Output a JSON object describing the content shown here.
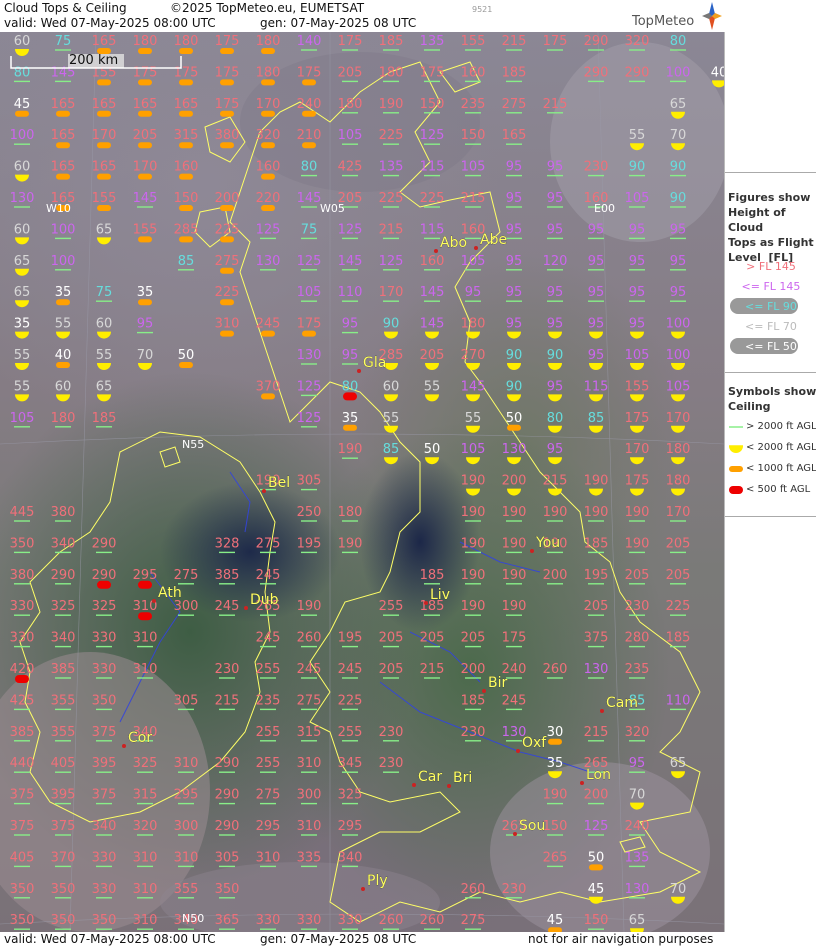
{
  "header": {
    "title": "Cloud Tops & Ceiling",
    "copyright": "©2025 TopMeteo.eu, EUMETSAT",
    "valid": "valid:  Wed   07-May-2025   08:00 UTC",
    "gen": "gen:  07-May-2025  08 UTC",
    "image_number": "9521",
    "brand": "TopMeteo"
  },
  "footer": {
    "valid": "valid:  Wed   07-May-2025   08:00 UTC",
    "gen": "gen:  07-May-2025  08 UTC",
    "disclaimer": "not for air navigation purposes"
  },
  "map": {
    "scale_label": "200 km",
    "grid_labels": [
      "W10",
      "W05",
      "E00",
      "N55",
      "N50"
    ],
    "cities": [
      "Abo",
      "Abe",
      "Gla",
      "Bel",
      "You",
      "Ath",
      "Dub",
      "Liv",
      "Bir",
      "Cam",
      "Cor",
      "Oxf",
      "Lon",
      "Car",
      "Bri",
      "Sou",
      "Ply"
    ],
    "colors": {
      "above_145": "#f0707a",
      "le_145": "#cc66ee",
      "le_90": "#66dddd",
      "le_70": "#d8d8d8",
      "le_50": "#ffffff",
      "ceiling_gt2000": "#88ee88",
      "ceiling_lt2000": "#ffee00",
      "ceiling_lt1000": "#ffa000",
      "ceiling_lt500": "#ee0000",
      "coast": "#ffff66",
      "river": "#3344dd"
    },
    "rows": [
      [
        "60",
        "75",
        "165",
        "180",
        "180",
        "175",
        "180",
        "140",
        "175",
        "185",
        "135",
        "155",
        "215",
        "175",
        "290",
        "320",
        "80"
      ],
      [
        "80",
        "145",
        "155",
        "175",
        "175",
        "175",
        "180",
        "175",
        "205",
        "180",
        "175",
        "160",
        "185",
        "",
        "290",
        "290",
        "100",
        "40"
      ],
      [
        "45",
        "165",
        "165",
        "165",
        "165",
        "175",
        "170",
        "240",
        "180",
        "190",
        "150",
        "235",
        "275",
        "215",
        "",
        "",
        "65"
      ],
      [
        "100",
        "165",
        "170",
        "205",
        "315",
        "380",
        "320",
        "210",
        "105",
        "225",
        "125",
        "150",
        "165",
        "",
        "",
        "55",
        "70"
      ],
      [
        "60",
        "165",
        "165",
        "170",
        "160",
        "",
        "160",
        "80",
        "425",
        "135",
        "115",
        "105",
        "95",
        "95",
        "230",
        "90",
        "90"
      ],
      [
        "130",
        "165",
        "155",
        "145",
        "150",
        "200",
        "220",
        "145",
        "205",
        "225",
        "225",
        "215",
        "95",
        "95",
        "160",
        "105",
        "90"
      ],
      [
        "60",
        "100",
        "65",
        "155",
        "285",
        "225",
        "125",
        "75",
        "125",
        "215",
        "115",
        "160",
        "95",
        "95",
        "95",
        "95",
        "95"
      ],
      [
        "65",
        "100",
        "",
        "",
        "85",
        "275",
        "130",
        "125",
        "145",
        "125",
        "160",
        "105",
        "95",
        "120",
        "95",
        "95",
        "95"
      ],
      [
        "65",
        "35",
        "75",
        "35",
        "",
        "225",
        "",
        "105",
        "110",
        "170",
        "145",
        "95",
        "95",
        "95",
        "95",
        "95",
        "95"
      ],
      [
        "35",
        "55",
        "60",
        "95",
        "",
        "310",
        "245",
        "175",
        "95",
        "90",
        "145",
        "180",
        "95",
        "95",
        "95",
        "95",
        "100"
      ],
      [
        "55",
        "40",
        "55",
        "70",
        "50",
        "",
        "",
        "130",
        "95",
        "285",
        "205",
        "270",
        "90",
        "90",
        "95",
        "105",
        "100"
      ],
      [
        "55",
        "60",
        "65",
        "",
        "",
        "",
        "370",
        "125",
        "80",
        "60",
        "55",
        "145",
        "90",
        "95",
        "115",
        "155",
        "105"
      ],
      [
        "105",
        "180",
        "185",
        "",
        "",
        "",
        "",
        "125",
        "35",
        "55",
        "",
        "55",
        "50",
        "80",
        "85",
        "175",
        "170"
      ],
      [
        "",
        "",
        "",
        "",
        "",
        "",
        "",
        "",
        "190",
        "85",
        "50",
        "105",
        "130",
        "95",
        "",
        "170",
        "180"
      ],
      [
        "",
        "",
        "",
        "",
        "",
        "",
        "190",
        "305",
        "",
        "",
        "",
        "190",
        "200",
        "215",
        "190",
        "175",
        "180"
      ],
      [
        "445",
        "380",
        "",
        "",
        "",
        "",
        "",
        "250",
        "180",
        "",
        "",
        "190",
        "190",
        "190",
        "190",
        "190",
        "170"
      ],
      [
        "350",
        "340",
        "290",
        "",
        "",
        "328",
        "275",
        "195",
        "190",
        "",
        "",
        "190",
        "190",
        "190",
        "185",
        "190",
        "205"
      ],
      [
        "380",
        "290",
        "290",
        "295",
        "275",
        "385",
        "245",
        "",
        "",
        "",
        "185",
        "190",
        "190",
        "200",
        "195",
        "205",
        "205"
      ],
      [
        "330",
        "325",
        "325",
        "310",
        "300",
        "245",
        "265",
        "190",
        "",
        "255",
        "185",
        "190",
        "190",
        "",
        "205",
        "230",
        "225"
      ],
      [
        "330",
        "340",
        "330",
        "310",
        "",
        "",
        "245",
        "260",
        "195",
        "205",
        "205",
        "205",
        "175",
        "",
        "375",
        "280",
        "185"
      ],
      [
        "420",
        "385",
        "330",
        "310",
        "",
        "230",
        "255",
        "245",
        "245",
        "205",
        "215",
        "200",
        "240",
        "260",
        "130",
        "235",
        ""
      ],
      [
        "425",
        "355",
        "350",
        "",
        "305",
        "215",
        "235",
        "275",
        "225",
        "",
        "",
        "185",
        "245",
        "",
        "",
        "85",
        "110"
      ],
      [
        "385",
        "355",
        "375",
        "340",
        "",
        "",
        "255",
        "315",
        "255",
        "230",
        "",
        "230",
        "130",
        "30",
        "215",
        "320",
        ""
      ],
      [
        "440",
        "405",
        "395",
        "325",
        "310",
        "290",
        "255",
        "310",
        "345",
        "230",
        "",
        "",
        "",
        "35",
        "265",
        "95",
        "65"
      ],
      [
        "375",
        "395",
        "375",
        "315",
        "295",
        "290",
        "275",
        "300",
        "325",
        "",
        "",
        "",
        "",
        "190",
        "200",
        "70",
        ""
      ],
      [
        "375",
        "375",
        "340",
        "320",
        "300",
        "290",
        "295",
        "310",
        "295",
        "",
        "",
        "",
        "265",
        "150",
        "125",
        "240",
        ""
      ],
      [
        "405",
        "370",
        "330",
        "310",
        "310",
        "305",
        "310",
        "335",
        "340",
        "",
        "",
        "",
        "",
        "265",
        "50",
        "135",
        ""
      ],
      [
        "350",
        "350",
        "330",
        "310",
        "355",
        "350",
        "",
        "",
        "",
        "",
        "",
        "260",
        "230",
        "",
        "45",
        "130",
        "70"
      ],
      [
        "350",
        "350",
        "350",
        "310",
        "340",
        "365",
        "330",
        "330",
        "330",
        "260",
        "260",
        "275",
        "",
        "45",
        "150",
        "65",
        ""
      ]
    ]
  }
}
